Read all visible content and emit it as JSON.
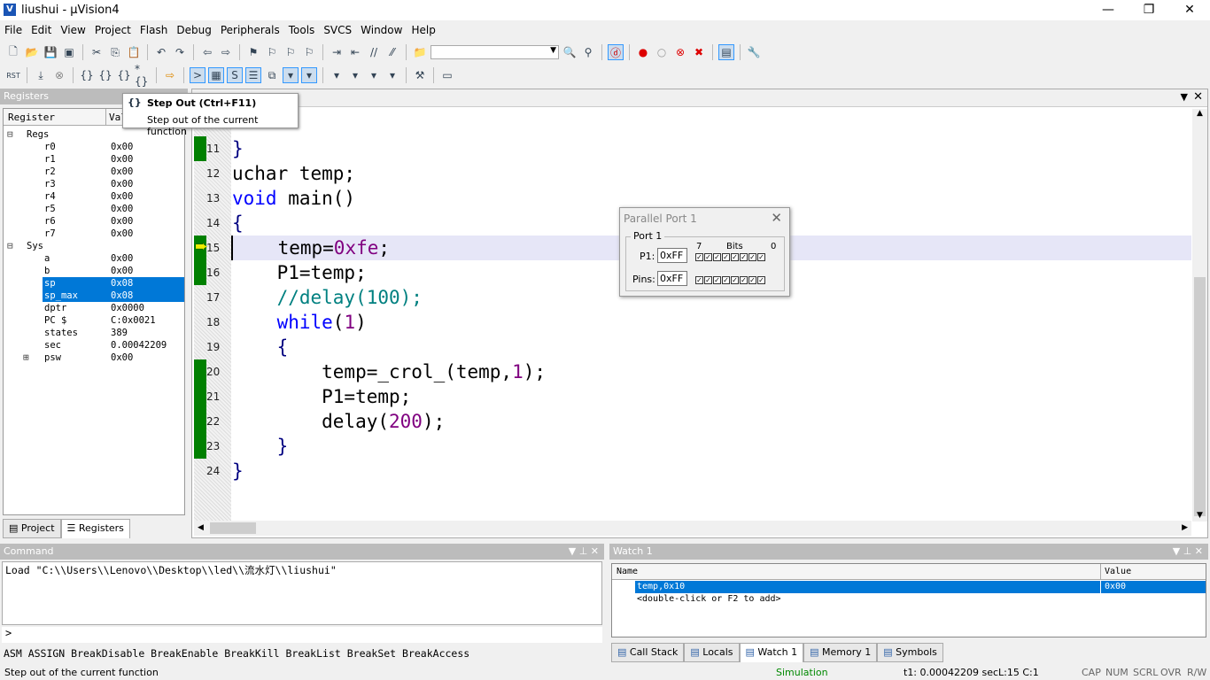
{
  "window": {
    "title": "liushui  - µVision4",
    "logo": "V"
  },
  "menu": [
    "File",
    "Edit",
    "View",
    "Project",
    "Flash",
    "Debug",
    "Peripherals",
    "Tools",
    "SVCS",
    "Window",
    "Help"
  ],
  "registers": {
    "title": "Registers",
    "col_register": "Register",
    "col_value": "Value",
    "rows": [
      {
        "name": "Regs",
        "value": "",
        "indent": 0,
        "expander": "−"
      },
      {
        "name": "r0",
        "value": "0x00",
        "indent": 2
      },
      {
        "name": "r1",
        "value": "0x00",
        "indent": 2
      },
      {
        "name": "r2",
        "value": "0x00",
        "indent": 2
      },
      {
        "name": "r3",
        "value": "0x00",
        "indent": 2
      },
      {
        "name": "r4",
        "value": "0x00",
        "indent": 2
      },
      {
        "name": "r5",
        "value": "0x00",
        "indent": 2
      },
      {
        "name": "r6",
        "value": "0x00",
        "indent": 2
      },
      {
        "name": "r7",
        "value": "0x00",
        "indent": 2
      },
      {
        "name": "Sys",
        "value": "",
        "indent": 0,
        "expander": "−"
      },
      {
        "name": "a",
        "value": "0x00",
        "indent": 2
      },
      {
        "name": "b",
        "value": "0x00",
        "indent": 2
      },
      {
        "name": "sp",
        "value": "0x08",
        "indent": 2,
        "selected": true
      },
      {
        "name": " sp_max",
        "value": "0x08",
        "indent": 2,
        "selected": true
      },
      {
        "name": "dptr",
        "value": "0x0000",
        "indent": 2
      },
      {
        "name": "PC  $",
        "value": "C:0x0021",
        "indent": 2
      },
      {
        "name": "states",
        "value": "389",
        "indent": 2
      },
      {
        "name": "sec",
        "value": "0.00042209",
        "indent": 2
      },
      {
        "name": "psw",
        "value": "0x00",
        "indent": 2,
        "expander": "+"
      }
    ],
    "tabs": [
      "Project",
      "Registers"
    ]
  },
  "tooltip": {
    "title": "Step Out (Ctrl+F11)",
    "desc": "Step out of the current function"
  },
  "editor": {
    "current_line": 15,
    "lines": [
      {
        "n": "11",
        "exec": true,
        "tokens": [
          [
            "}",
            "br"
          ]
        ]
      },
      {
        "n": "12",
        "tokens": [
          [
            "uchar temp;",
            "tx"
          ]
        ]
      },
      {
        "n": "13",
        "tokens": [
          [
            "void",
            "kw"
          ],
          [
            " main()",
            "tx"
          ]
        ]
      },
      {
        "n": "14",
        "tokens": [
          [
            "{",
            "br"
          ]
        ]
      },
      {
        "n": "15",
        "exec": true,
        "current": true,
        "tokens": [
          [
            "    temp=",
            "tx"
          ],
          [
            "0xfe",
            "num"
          ],
          [
            ";",
            "tx"
          ]
        ]
      },
      {
        "n": "16",
        "exec": true,
        "tokens": [
          [
            "    P1=temp;",
            "tx"
          ]
        ]
      },
      {
        "n": "17",
        "tokens": [
          [
            "    //delay(100);",
            "cm"
          ]
        ]
      },
      {
        "n": "18",
        "tokens": [
          [
            "    ",
            "tx"
          ],
          [
            "while",
            "kw"
          ],
          [
            "(",
            "tx"
          ],
          [
            "1",
            "num"
          ],
          [
            ")",
            "tx"
          ]
        ]
      },
      {
        "n": "19",
        "tokens": [
          [
            "    ",
            "tx"
          ],
          [
            "{",
            "br"
          ]
        ]
      },
      {
        "n": "20",
        "exec": true,
        "tokens": [
          [
            "        temp=_crol_(temp,",
            "tx"
          ],
          [
            "1",
            "num"
          ],
          [
            ");",
            "tx"
          ]
        ]
      },
      {
        "n": "21",
        "exec": true,
        "tokens": [
          [
            "        P1=temp;",
            "tx"
          ]
        ]
      },
      {
        "n": "22",
        "exec": true,
        "tokens": [
          [
            "        delay(",
            "tx"
          ],
          [
            "200",
            "num"
          ],
          [
            ");",
            "tx"
          ]
        ]
      },
      {
        "n": "23",
        "exec": true,
        "tokens": [
          [
            "    ",
            "tx"
          ],
          [
            "}",
            "br"
          ]
        ]
      },
      {
        "n": "24",
        "tokens": [
          [
            "}",
            "br"
          ]
        ]
      }
    ]
  },
  "parallel_port": {
    "title": "Parallel Port 1",
    "group": "Port 1",
    "bit_hi": "7",
    "bits": "Bits",
    "bit_lo": "0",
    "p1_label": "P1:",
    "p1_value": "0xFF",
    "pins_label": "Pins:",
    "pins_value": "0xFF",
    "p1_bits": [
      1,
      1,
      1,
      1,
      1,
      1,
      1,
      1
    ],
    "pins_bits": [
      1,
      1,
      1,
      1,
      1,
      1,
      1,
      1
    ]
  },
  "command": {
    "title": "Command",
    "output": "Load \"C:\\\\Users\\\\Lenovo\\\\Desktop\\\\led\\\\流水灯\\\\liushui\"",
    "prompt": ">",
    "hints": "ASM ASSIGN BreakDisable BreakEnable BreakKill BreakList BreakSet BreakAccess"
  },
  "watch": {
    "title": "Watch 1",
    "col_name": "Name",
    "col_value": "Value",
    "rows": [
      {
        "name": "temp,0x10",
        "value": "0x00",
        "selected": true
      },
      {
        "name": "<double-click or F2 to add>",
        "value": ""
      }
    ],
    "tabs": [
      "Call Stack",
      "Locals",
      "Watch 1",
      "Memory 1",
      "Symbols"
    ],
    "active_tab": "Watch 1"
  },
  "status": {
    "message": "Step out of the current function",
    "mode": "Simulation",
    "time": "t1: 0.00042209 sec",
    "pos": "L:15 C:1",
    "indicators": [
      "CAP",
      "NUM",
      "SCRL",
      "OVR",
      "R/W"
    ]
  },
  "colors": {
    "selection": "#0078d7",
    "exec_marker": "#008000",
    "keyword": "#0000ff",
    "number": "#800080",
    "comment": "#008080"
  }
}
